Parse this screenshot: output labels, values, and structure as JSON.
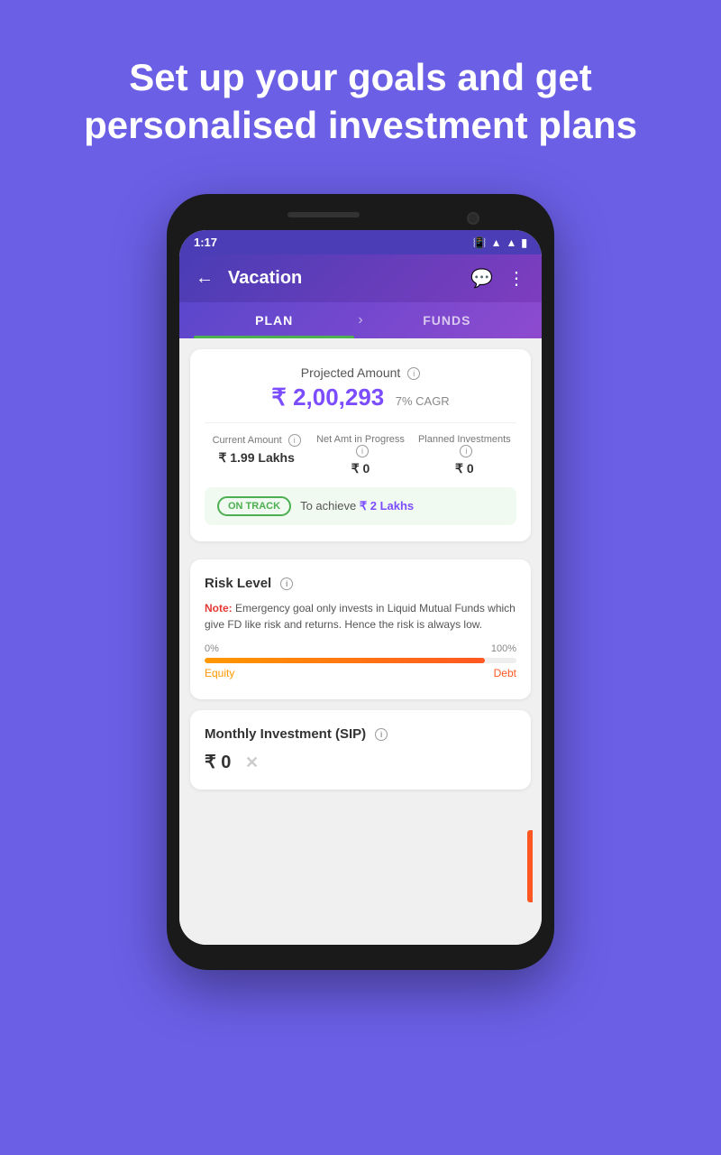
{
  "page": {
    "hero_title": "Set up your goals and get personalised investment plans"
  },
  "status_bar": {
    "time": "1:17",
    "icons": [
      "📷",
      "📳",
      "📶",
      "📶",
      "🔋"
    ]
  },
  "header": {
    "title": "Vacation",
    "back_label": "←",
    "chat_icon": "💬",
    "more_icon": "⋮"
  },
  "tabs": {
    "plan_label": "PLAN",
    "funds_label": "FUNDS"
  },
  "projected": {
    "label": "Projected Amount",
    "amount": "₹ 2,00,293",
    "cagr": "7% CAGR"
  },
  "stats": {
    "current_amount_label": "Current Amount",
    "current_amount_value": "₹ 1.99 Lakhs",
    "net_amt_label": "Net Amt in Progress",
    "net_amt_value": "₹ 0",
    "planned_label": "Planned Investments",
    "planned_value": "₹ 0"
  },
  "on_track": {
    "badge": "ON TRACK",
    "text": "To achieve",
    "amount": "₹ 2 Lakhs"
  },
  "risk": {
    "section_title": "Risk Level",
    "note_label": "Note:",
    "note_text": " Emergency goal only invests in Liquid Mutual Funds which give FD like risk and returns. Hence the risk is always low.",
    "bar_start": "0%",
    "bar_end": "100%",
    "bar_fill_percent": 90,
    "equity_label": "Equity",
    "debt_label": "Debt"
  },
  "monthly": {
    "section_title": "Monthly Investment (SIP)",
    "amount": "₹ 0"
  }
}
